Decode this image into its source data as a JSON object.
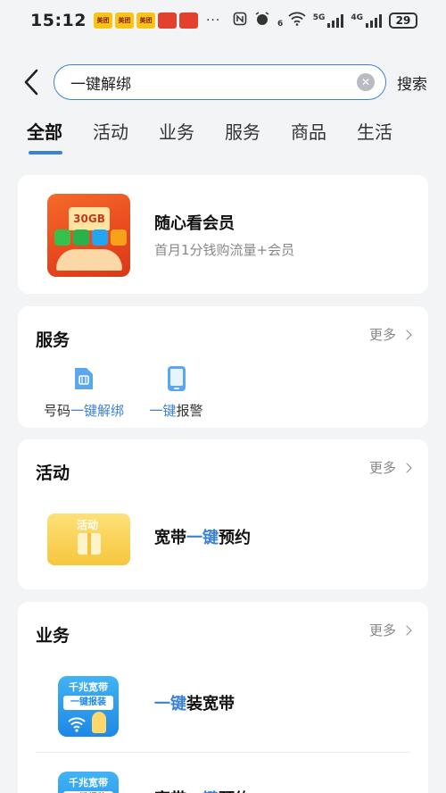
{
  "status_bar": {
    "time": "15:12",
    "mini_apps": [
      "美团",
      "美团",
      "美团",
      "",
      ""
    ],
    "more": "···",
    "network_1": "6",
    "network_2": "5G",
    "network_3": "4G",
    "battery": "29"
  },
  "search": {
    "value": "一键解绑",
    "search_button": "搜索"
  },
  "tabs": [
    "全部",
    "活动",
    "业务",
    "服务",
    "商品",
    "生活"
  ],
  "active_tab": "全部",
  "hero": {
    "badge": "30GB",
    "title": "随心看会员",
    "subtitle": "首月1分钱购流量+会员"
  },
  "services": {
    "title": "服务",
    "more": "更多",
    "items": [
      {
        "prefix": "号码",
        "highlight": "一键解绑",
        "suffix": ""
      },
      {
        "prefix": "",
        "highlight": "一键",
        "suffix": "报警"
      }
    ]
  },
  "activities": {
    "title": "活动",
    "more": "更多",
    "image_label": "活动",
    "items": [
      {
        "prefix": "宽带",
        "highlight": "一键",
        "suffix": "预约"
      }
    ]
  },
  "business": {
    "title": "业务",
    "more": "更多",
    "image_line1": "千兆宽带",
    "image_line2": "一键报装",
    "items": [
      {
        "prefix": "",
        "highlight": "一键",
        "suffix": "装宽带"
      },
      {
        "prefix": "宽带",
        "highlight": "一键",
        "suffix": "预约"
      }
    ]
  },
  "colors": {
    "accent": "#3b82d6",
    "background": "#f3f4f6",
    "card": "#ffffff"
  }
}
